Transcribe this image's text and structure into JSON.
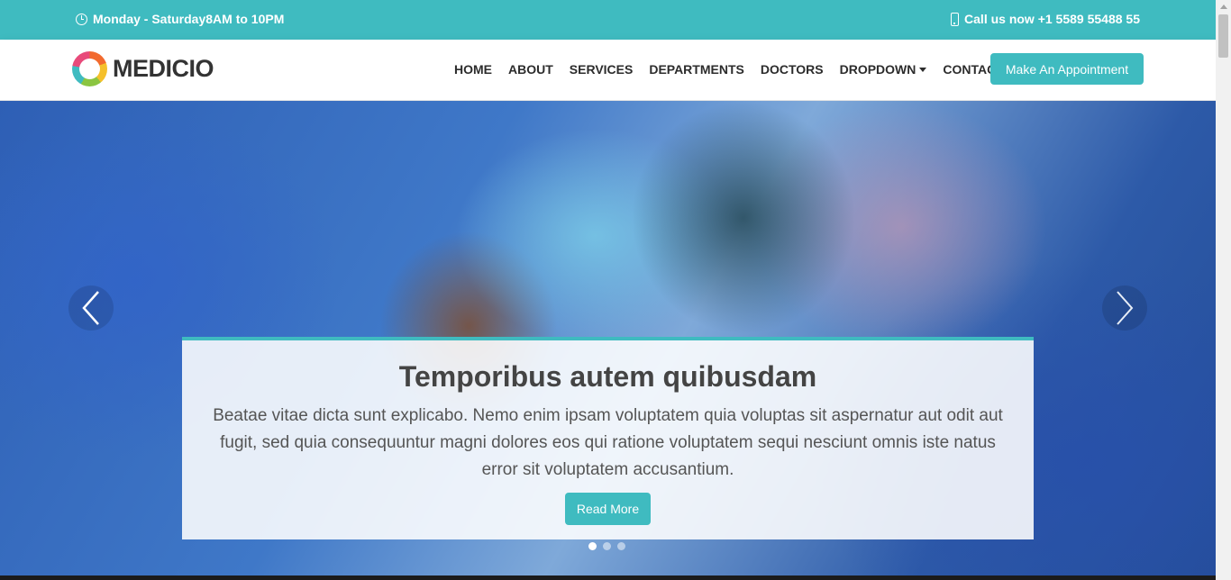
{
  "topbar": {
    "hours": "Monday - Saturday8AM to 10PM",
    "phone": "Call us now +1 5589 55488 55",
    "color": "#3fbbc0"
  },
  "brand": {
    "name": "MEDICIO"
  },
  "nav": {
    "items": [
      {
        "label": "HOME"
      },
      {
        "label": "ABOUT"
      },
      {
        "label": "SERVICES"
      },
      {
        "label": "DEPARTMENTS"
      },
      {
        "label": "DOCTORS"
      },
      {
        "label": "DROPDOWN"
      },
      {
        "label": "CONTACT"
      }
    ],
    "appointment_button": "Make An Appointment"
  },
  "hero": {
    "title": "Temporibus autem quibusdam",
    "text": "Beatae vitae dicta sunt explicabo. Nemo enim ipsam voluptatem quia voluptas sit aspernatur aut odit aut fugit, sed quia consequuntur magni dolores eos qui ratione voluptatem sequi nesciunt omnis iste natus error sit voluptatem accusantium.",
    "button": "Read More",
    "slides": 3,
    "active_slide": 1
  },
  "icons": {
    "hours": "clock-icon",
    "phone": "phone-icon",
    "prev": "chevron-left-icon",
    "next": "chevron-right-icon",
    "dropdown": "caret-down-icon"
  }
}
